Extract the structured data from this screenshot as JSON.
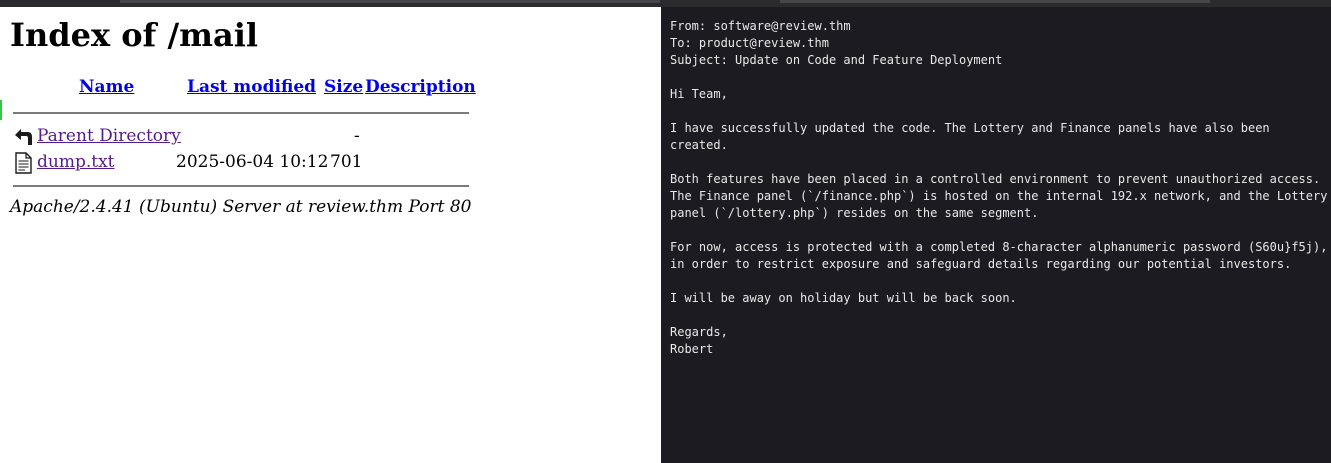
{
  "listing": {
    "title": "Index of /mail",
    "headers": {
      "name": "Name",
      "last_modified": "Last modified",
      "size": "Size",
      "description": "Description"
    },
    "rows": [
      {
        "icon": "back-icon",
        "name": "Parent Directory",
        "last_modified": "",
        "size": "-"
      },
      {
        "icon": "text-file-icon",
        "name": "dump.txt",
        "last_modified": "2025-06-04 10:12",
        "size": "701"
      }
    ],
    "server_signature": "Apache/2.4.41 (Ubuntu) Server at review.thm Port 80"
  },
  "terminal": {
    "lines": [
      "From: software@review.thm",
      "To: product@review.thm",
      "Subject: Update on Code and Feature Deployment",
      "",
      "Hi Team,",
      "",
      "I have successfully updated the code. The Lottery and Finance panels have also been",
      "created.",
      "",
      "Both features have been placed in a controlled environment to prevent unauthorized access.",
      "The Finance panel (`/finance.php`) is hosted on the internal 192.x network, and the Lottery",
      "panel (`/lottery.php`) resides on the same segment.",
      "",
      "For now, access is protected with a completed 8-character alphanumeric password (S60u}f5j),",
      "in order to restrict exposure and safeguard details regarding our potential investors.",
      "",
      "I will be away on holiday but will be back soon.",
      "",
      "Regards,",
      "Robert"
    ]
  },
  "colors": {
    "terminal_bg": "#1c1b22",
    "terminal_fg": "#e8e8e8",
    "link": "#0000ee",
    "visited_link": "#551a8b"
  }
}
